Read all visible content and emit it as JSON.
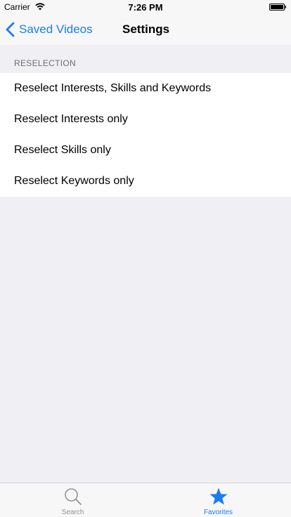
{
  "status_bar": {
    "carrier": "Carrier",
    "time": "7:26 PM"
  },
  "nav_bar": {
    "back_label": "Saved Videos",
    "title": "Settings",
    "accent_color": "#1a7cf5"
  },
  "section": {
    "header": "RESELECTION",
    "items": [
      {
        "label": "Reselect Interests, Skills and Keywords"
      },
      {
        "label": "Reselect Interests only"
      },
      {
        "label": "Reselect Skills only"
      },
      {
        "label": "Reselect Keywords only"
      }
    ]
  },
  "tab_bar": {
    "tabs": [
      {
        "label": "Search",
        "icon": "search-icon",
        "selected": false
      },
      {
        "label": "Favorites",
        "icon": "star-icon",
        "selected": true
      }
    ]
  }
}
